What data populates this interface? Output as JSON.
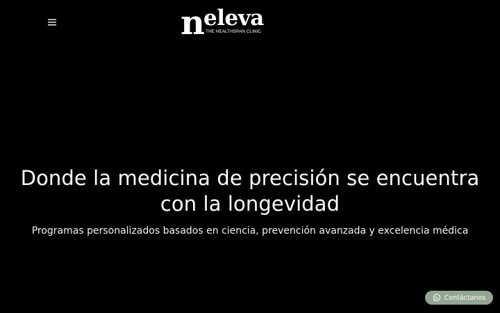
{
  "header": {
    "menu_icon": "hamburger-menu-icon",
    "logo": {
      "wordmark_first": "n",
      "wordmark_rest": "eleva",
      "tagline": "THE HEALTHSPAN CLINIC"
    }
  },
  "hero": {
    "title": "Donde la medicina de precisión se encuentra con la longevidad",
    "subtitle": "Programas personalizados basados en ciencia, prevención avanzada y excelencia médica"
  },
  "contact_button": {
    "label": "Contáctanos",
    "icon": "whatsapp-icon"
  },
  "colors": {
    "background": "#000000",
    "text": "#ffffff",
    "contact_button_bg": "#94a594"
  }
}
